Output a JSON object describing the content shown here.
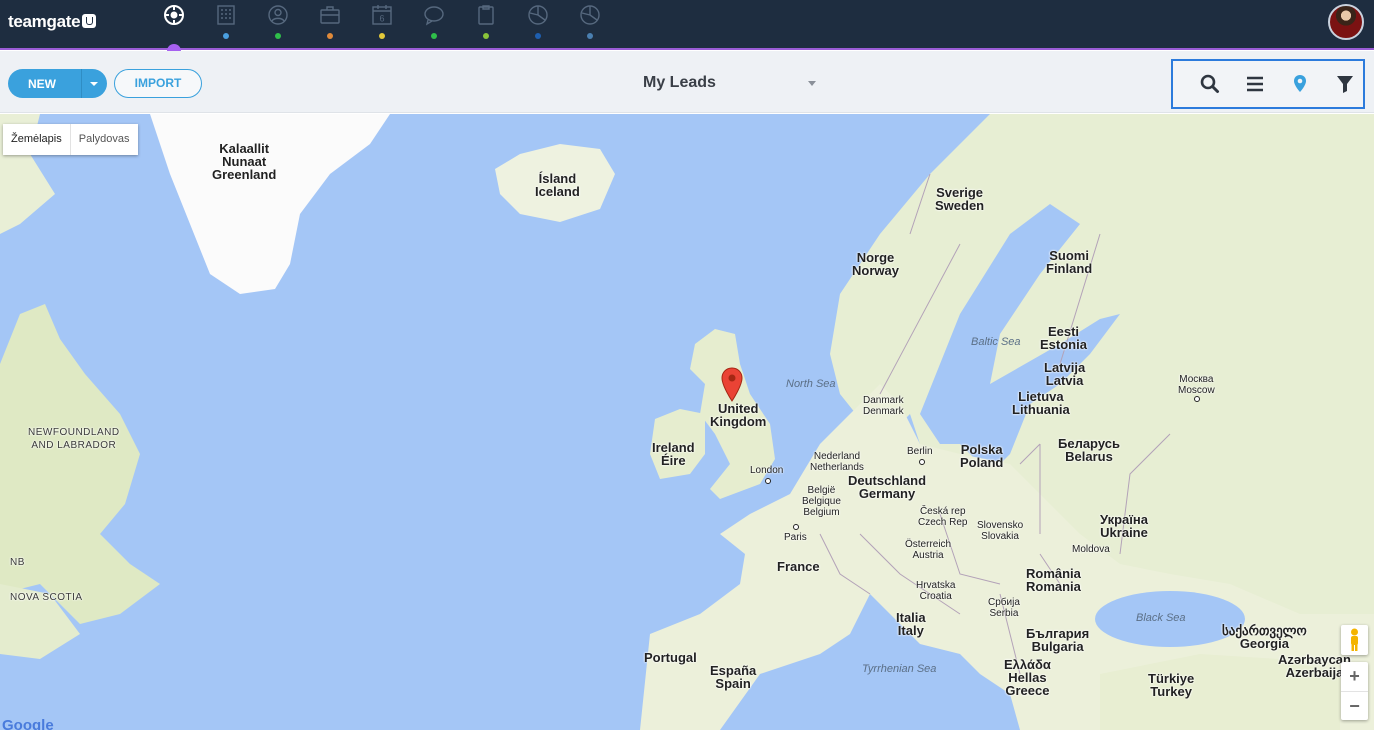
{
  "app": {
    "logo_text": "teamgate",
    "nav_icons": [
      {
        "name": "dashboard-icon",
        "dot_color": ""
      },
      {
        "name": "companies-icon",
        "dot_color": "#4a9fe0"
      },
      {
        "name": "people-icon",
        "dot_color": "#2fbf4a"
      },
      {
        "name": "deals-icon",
        "dot_color": "#e08a3a"
      },
      {
        "name": "calendar-icon",
        "dot_color": "#e3c93a",
        "badge": "6"
      },
      {
        "name": "messages-icon",
        "dot_color": "#2fbf4a"
      },
      {
        "name": "documents-icon",
        "dot_color": "#8ac43a"
      },
      {
        "name": "reports-icon",
        "dot_color": "#1e5fb0"
      },
      {
        "name": "insights-icon",
        "dot_color": "#4a7fb0"
      }
    ],
    "accent_color": "#9a5cd6",
    "nav_bg": "#1e2d40"
  },
  "toolbar": {
    "new_label": "NEW",
    "import_label": "IMPORT",
    "view_title": "My Leads",
    "tools": [
      "search-icon",
      "list-icon",
      "map-pin-icon",
      "filter-icon"
    ]
  },
  "map": {
    "type_control": {
      "map": "Žemėlapis",
      "satellite": "Palydovas"
    },
    "labels": {
      "greenland": [
        "Kalaallit",
        "Nunaat",
        "Greenland"
      ],
      "iceland": [
        "Ísland",
        "Iceland"
      ],
      "sweden": [
        "Sverige",
        "Sweden"
      ],
      "norway": [
        "Norge",
        "Norway"
      ],
      "finland": [
        "Suomi",
        "Finland"
      ],
      "estonia": [
        "Eesti",
        "Estonia"
      ],
      "latvia": [
        "Latvija",
        "Latvia"
      ],
      "lithuania": [
        "Lietuva",
        "Lithuania"
      ],
      "uk": [
        "United",
        "Kingdom"
      ],
      "ireland": [
        "Ireland",
        "Éire"
      ],
      "denmark": [
        "Danmark",
        "Denmark"
      ],
      "netherlands": [
        "Nederland",
        "Netherlands"
      ],
      "belgium": [
        "België",
        "Belgique",
        "Belgium"
      ],
      "germany": [
        "Deutschland",
        "Germany"
      ],
      "poland": [
        "Polska",
        "Poland"
      ],
      "belarus": [
        "Беларусь",
        "Belarus"
      ],
      "czech": [
        "Česká rep",
        "Czech Rep"
      ],
      "slovakia": [
        "Slovensko",
        "Slovakia"
      ],
      "austria": [
        "Österreich",
        "Austria"
      ],
      "ukraine": [
        "Україна",
        "Ukraine"
      ],
      "moldova": "Moldova",
      "romania": [
        "România",
        "Romania"
      ],
      "croatia": [
        "Hrvatska",
        "Croatia"
      ],
      "serbia": [
        "Србија",
        "Serbia"
      ],
      "bulgaria": [
        "България",
        "Bulgaria"
      ],
      "greece": [
        "Ελλάδα",
        "Hellas",
        "Greece"
      ],
      "italy": [
        "Italia",
        "Italy"
      ],
      "france": "France",
      "spain": [
        "España",
        "Spain"
      ],
      "portugal": "Portugal",
      "turkey": [
        "Türkiye",
        "Turkey"
      ],
      "georgia": [
        "საქართველო",
        "Georgia"
      ],
      "azerbaijan": [
        "Azərbaycan",
        "Azerbaija"
      ],
      "moscow": [
        "Москва",
        "Moscow"
      ],
      "london": "London",
      "paris": "Paris",
      "berlin": "Berlin",
      "north_sea": "North Sea",
      "baltic_sea": "Baltic Sea",
      "black_sea": "Black Sea",
      "tyrrhenian_sea": "Tyrrhenian Sea",
      "newfoundland": [
        "NEWFOUNDLAND",
        "AND LABRADOR"
      ],
      "nova_scotia": "NOVA SCOTIA",
      "nb": "NB"
    },
    "zoom_in": "+",
    "zoom_out": "−",
    "attribution": "Google",
    "land_color": "#eaf0d9",
    "water_color": "#a4c6f6",
    "greenland_color": "#fbfbfb"
  }
}
